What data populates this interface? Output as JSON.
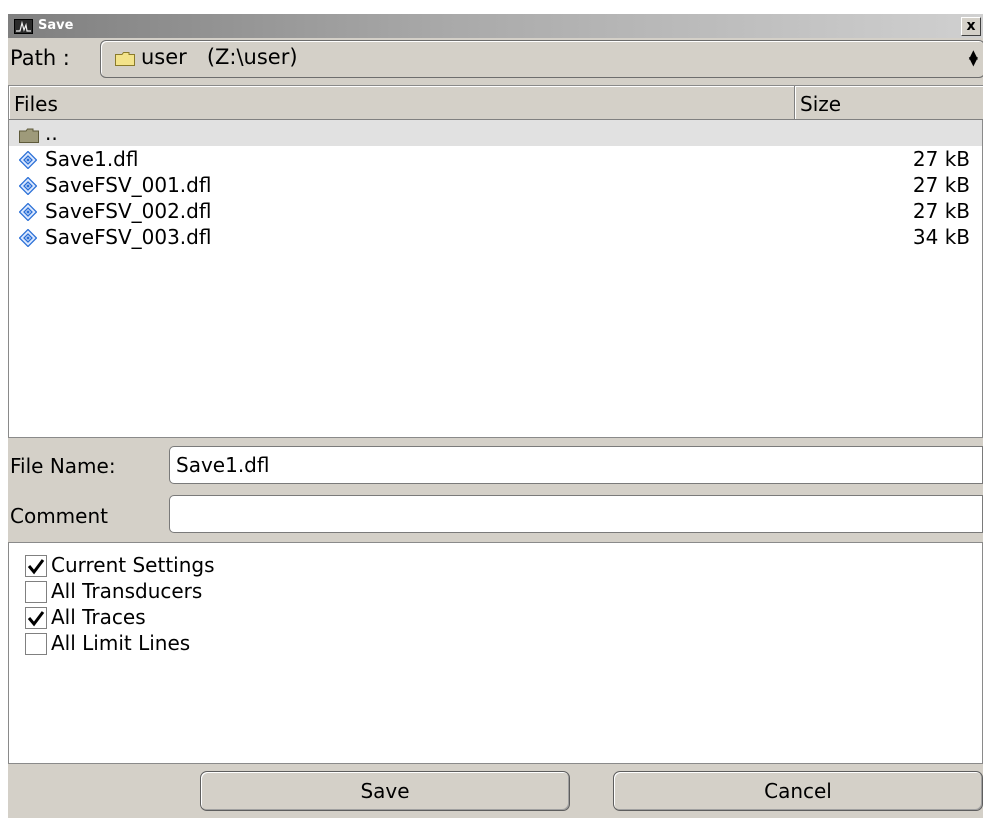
{
  "window": {
    "title": "Save",
    "close_glyph": "x"
  },
  "path": {
    "label": "Path :",
    "value": "user   (Z:\\user)",
    "spin_up": "▲",
    "spin_down": "▼"
  },
  "filelist": {
    "columns": {
      "files": "Files",
      "size": "Size"
    },
    "parent_label": "..",
    "files": [
      {
        "name": "Save1.dfl",
        "size": "27 kB"
      },
      {
        "name": "SaveFSV_001.dfl",
        "size": "27 kB"
      },
      {
        "name": "SaveFSV_002.dfl",
        "size": "27 kB"
      },
      {
        "name": "SaveFSV_003.dfl",
        "size": "34 kB"
      }
    ]
  },
  "fields": {
    "file_name_label": "File Name:",
    "file_name_value": "Save1.dfl",
    "comment_label": "Comment",
    "comment_value": ""
  },
  "options": [
    {
      "label": "Current Settings",
      "checked": true
    },
    {
      "label": "All Transducers",
      "checked": false
    },
    {
      "label": "All Traces",
      "checked": true
    },
    {
      "label": "All Limit Lines",
      "checked": false
    }
  ],
  "buttons": {
    "save": "Save",
    "cancel": "Cancel"
  },
  "colors": {
    "dialog_bg": "#d4d0c8",
    "parent_row_bg": "#e1e1e1",
    "file_icon": "#2a6fd6",
    "folder_icon": "#f3e38a"
  }
}
